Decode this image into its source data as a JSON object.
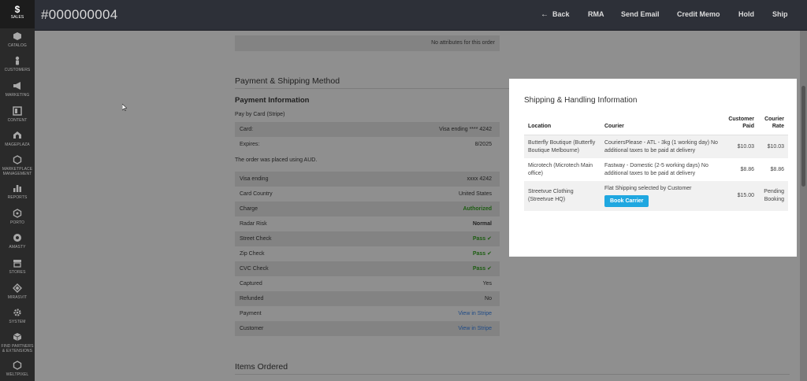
{
  "sidebar": {
    "items": [
      {
        "label": "SALES",
        "icon": "dollar-icon"
      },
      {
        "label": "CATALOG",
        "icon": "cube-icon"
      },
      {
        "label": "CUSTOMERS",
        "icon": "person-icon"
      },
      {
        "label": "MARKETING",
        "icon": "megaphone-icon"
      },
      {
        "label": "CONTENT",
        "icon": "layout-icon"
      },
      {
        "label": "MAGEPLAZA",
        "icon": "mageplaza-icon"
      },
      {
        "label": "MARKETPLACE MANAGEMENT",
        "icon": "hexagon-icon"
      },
      {
        "label": "REPORTS",
        "icon": "bar-chart-icon"
      },
      {
        "label": "PORTO",
        "icon": "porto-icon"
      },
      {
        "label": "AMASTY",
        "icon": "amasty-icon"
      },
      {
        "label": "STORES",
        "icon": "store-icon"
      },
      {
        "label": "MIRASVIT",
        "icon": "mirasvit-icon"
      },
      {
        "label": "SYSTEM",
        "icon": "gear-icon"
      },
      {
        "label": "FIND PARTNERS & EXTENSIONS",
        "icon": "boxes-icon"
      },
      {
        "label": "WELTPIXEL",
        "icon": "weltpixel-icon"
      }
    ]
  },
  "header": {
    "title": "#000000004",
    "actions": {
      "back": "Back",
      "rma": "RMA",
      "send_email": "Send Email",
      "credit_memo": "Credit Memo",
      "hold": "Hold",
      "ship": "Ship"
    }
  },
  "main": {
    "no_attributes": "No attributes for this order",
    "payment_shipping_title": "Payment & Shipping Method",
    "payment_info_title": "Payment Information",
    "pay_by": "Pay by Card (Stripe)",
    "card_rows": [
      {
        "key": "Card:",
        "value": "Visa ending **** 4242"
      },
      {
        "key": "Expires:",
        "value": "8/2025"
      }
    ],
    "currency_note": "The order was placed using AUD.",
    "stripe_rows": [
      {
        "key": "Visa ending",
        "value": "xxxx 4242"
      },
      {
        "key": "Card Country",
        "value": "United States"
      },
      {
        "key": "Charge",
        "value": "Authorized"
      },
      {
        "key": "Radar Risk",
        "value": "Normal"
      },
      {
        "key": "Street Check",
        "value": "Pass ✔"
      },
      {
        "key": "Zip Check",
        "value": "Pass ✔"
      },
      {
        "key": "CVC Check",
        "value": "Pass ✔"
      },
      {
        "key": "Captured",
        "value": "Yes"
      },
      {
        "key": "Refunded",
        "value": "No"
      },
      {
        "key": "Payment",
        "value": "View in Stripe"
      },
      {
        "key": "Customer",
        "value": "View in Stripe"
      }
    ],
    "items_ordered_title": "Items Ordered"
  },
  "modal": {
    "title": "Shipping & Handling Information",
    "headers": {
      "location": "Location",
      "courier": "Courier",
      "customer_paid": "Customer Paid",
      "courier_rate": "Courier Rate"
    },
    "rows": [
      {
        "location": "Butterfly Boutique (Butterfly Boutique Melbourne)",
        "courier": "CouriersPlease - ATL - 3kg (1 working day) No additional taxes to be paid at delivery",
        "paid": "$10.03",
        "rate": "$10.03"
      },
      {
        "location": "Microtech (Microtech Main office)",
        "courier": "Fastway - Domestic (2-5 working days) No additional taxes to be paid at delivery",
        "paid": "$8.86",
        "rate": "$8.86"
      },
      {
        "location": "Streetvue Clothing (Streetvue HQ)",
        "courier": "Flat Shipping selected by Customer",
        "paid": "$15.00",
        "rate": "Pending Booking"
      }
    ],
    "book_button": "Book Carrier"
  },
  "colors": {
    "sidebar_bg": "#2a2a2a",
    "header_bg": "#2d3038",
    "overlay_bg": "#8f8f8f",
    "button_accent": "#1fa7e0",
    "pass_green": "#1d5d12",
    "link_blue": "#1e4a86"
  }
}
